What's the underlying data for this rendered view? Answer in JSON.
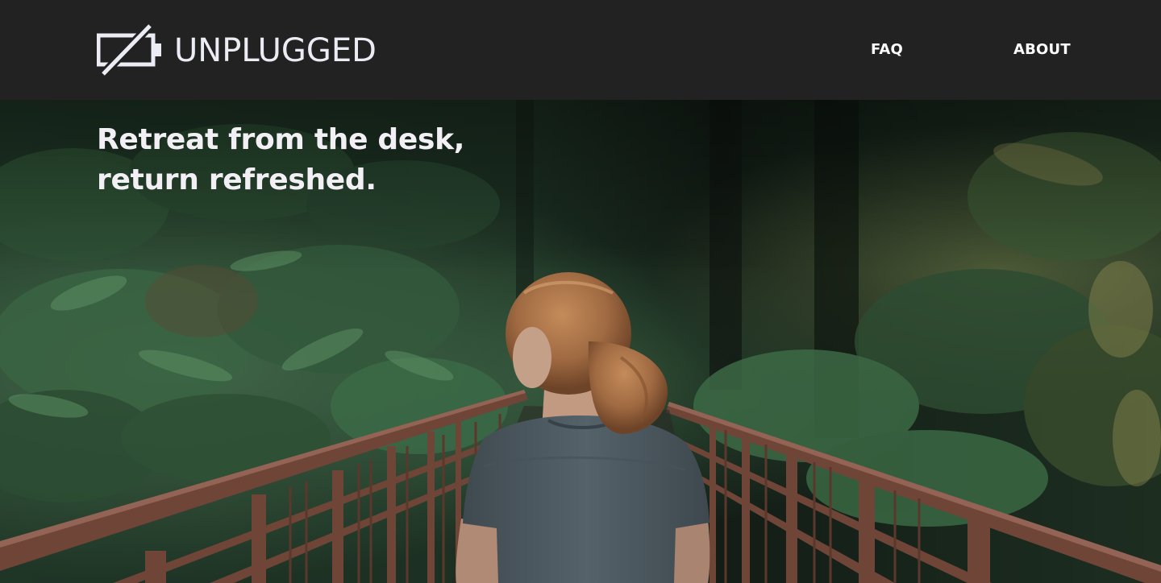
{
  "brand": {
    "name": "UNPLUGGED",
    "icon": "unplugged-battery-icon"
  },
  "nav": {
    "items": [
      {
        "label": "FAQ"
      },
      {
        "label": "ABOUT"
      }
    ]
  },
  "hero": {
    "heading": "Retreat from the desk, return refreshed.",
    "image": "woman-on-forest-bridge-photo"
  },
  "colors": {
    "header_bg": "#222222",
    "text": "#ffffff",
    "logo_text": "#ececf4",
    "forest_dark": "#1b2b20",
    "bridge_rust": "#7a4a3a",
    "shirt": "#4d5a60",
    "hair": "#a66f45"
  }
}
